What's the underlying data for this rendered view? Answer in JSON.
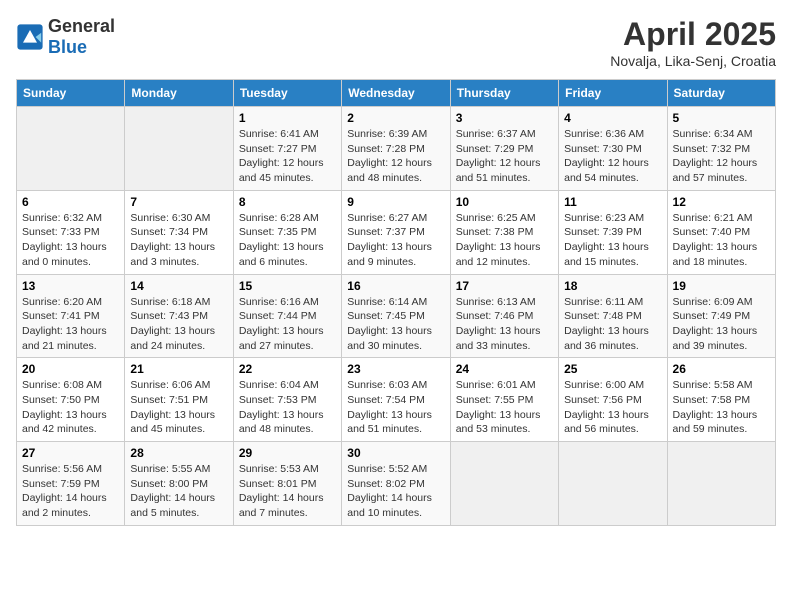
{
  "logo": {
    "text_general": "General",
    "text_blue": "Blue"
  },
  "title": "April 2025",
  "subtitle": "Novalja, Lika-Senj, Croatia",
  "days_of_week": [
    "Sunday",
    "Monday",
    "Tuesday",
    "Wednesday",
    "Thursday",
    "Friday",
    "Saturday"
  ],
  "weeks": [
    [
      {
        "day": "",
        "info": ""
      },
      {
        "day": "",
        "info": ""
      },
      {
        "day": "1",
        "info": "Sunrise: 6:41 AM\nSunset: 7:27 PM\nDaylight: 12 hours\nand 45 minutes."
      },
      {
        "day": "2",
        "info": "Sunrise: 6:39 AM\nSunset: 7:28 PM\nDaylight: 12 hours\nand 48 minutes."
      },
      {
        "day": "3",
        "info": "Sunrise: 6:37 AM\nSunset: 7:29 PM\nDaylight: 12 hours\nand 51 minutes."
      },
      {
        "day": "4",
        "info": "Sunrise: 6:36 AM\nSunset: 7:30 PM\nDaylight: 12 hours\nand 54 minutes."
      },
      {
        "day": "5",
        "info": "Sunrise: 6:34 AM\nSunset: 7:32 PM\nDaylight: 12 hours\nand 57 minutes."
      }
    ],
    [
      {
        "day": "6",
        "info": "Sunrise: 6:32 AM\nSunset: 7:33 PM\nDaylight: 13 hours\nand 0 minutes."
      },
      {
        "day": "7",
        "info": "Sunrise: 6:30 AM\nSunset: 7:34 PM\nDaylight: 13 hours\nand 3 minutes."
      },
      {
        "day": "8",
        "info": "Sunrise: 6:28 AM\nSunset: 7:35 PM\nDaylight: 13 hours\nand 6 minutes."
      },
      {
        "day": "9",
        "info": "Sunrise: 6:27 AM\nSunset: 7:37 PM\nDaylight: 13 hours\nand 9 minutes."
      },
      {
        "day": "10",
        "info": "Sunrise: 6:25 AM\nSunset: 7:38 PM\nDaylight: 13 hours\nand 12 minutes."
      },
      {
        "day": "11",
        "info": "Sunrise: 6:23 AM\nSunset: 7:39 PM\nDaylight: 13 hours\nand 15 minutes."
      },
      {
        "day": "12",
        "info": "Sunrise: 6:21 AM\nSunset: 7:40 PM\nDaylight: 13 hours\nand 18 minutes."
      }
    ],
    [
      {
        "day": "13",
        "info": "Sunrise: 6:20 AM\nSunset: 7:41 PM\nDaylight: 13 hours\nand 21 minutes."
      },
      {
        "day": "14",
        "info": "Sunrise: 6:18 AM\nSunset: 7:43 PM\nDaylight: 13 hours\nand 24 minutes."
      },
      {
        "day": "15",
        "info": "Sunrise: 6:16 AM\nSunset: 7:44 PM\nDaylight: 13 hours\nand 27 minutes."
      },
      {
        "day": "16",
        "info": "Sunrise: 6:14 AM\nSunset: 7:45 PM\nDaylight: 13 hours\nand 30 minutes."
      },
      {
        "day": "17",
        "info": "Sunrise: 6:13 AM\nSunset: 7:46 PM\nDaylight: 13 hours\nand 33 minutes."
      },
      {
        "day": "18",
        "info": "Sunrise: 6:11 AM\nSunset: 7:48 PM\nDaylight: 13 hours\nand 36 minutes."
      },
      {
        "day": "19",
        "info": "Sunrise: 6:09 AM\nSunset: 7:49 PM\nDaylight: 13 hours\nand 39 minutes."
      }
    ],
    [
      {
        "day": "20",
        "info": "Sunrise: 6:08 AM\nSunset: 7:50 PM\nDaylight: 13 hours\nand 42 minutes."
      },
      {
        "day": "21",
        "info": "Sunrise: 6:06 AM\nSunset: 7:51 PM\nDaylight: 13 hours\nand 45 minutes."
      },
      {
        "day": "22",
        "info": "Sunrise: 6:04 AM\nSunset: 7:53 PM\nDaylight: 13 hours\nand 48 minutes."
      },
      {
        "day": "23",
        "info": "Sunrise: 6:03 AM\nSunset: 7:54 PM\nDaylight: 13 hours\nand 51 minutes."
      },
      {
        "day": "24",
        "info": "Sunrise: 6:01 AM\nSunset: 7:55 PM\nDaylight: 13 hours\nand 53 minutes."
      },
      {
        "day": "25",
        "info": "Sunrise: 6:00 AM\nSunset: 7:56 PM\nDaylight: 13 hours\nand 56 minutes."
      },
      {
        "day": "26",
        "info": "Sunrise: 5:58 AM\nSunset: 7:58 PM\nDaylight: 13 hours\nand 59 minutes."
      }
    ],
    [
      {
        "day": "27",
        "info": "Sunrise: 5:56 AM\nSunset: 7:59 PM\nDaylight: 14 hours\nand 2 minutes."
      },
      {
        "day": "28",
        "info": "Sunrise: 5:55 AM\nSunset: 8:00 PM\nDaylight: 14 hours\nand 5 minutes."
      },
      {
        "day": "29",
        "info": "Sunrise: 5:53 AM\nSunset: 8:01 PM\nDaylight: 14 hours\nand 7 minutes."
      },
      {
        "day": "30",
        "info": "Sunrise: 5:52 AM\nSunset: 8:02 PM\nDaylight: 14 hours\nand 10 minutes."
      },
      {
        "day": "",
        "info": ""
      },
      {
        "day": "",
        "info": ""
      },
      {
        "day": "",
        "info": ""
      }
    ]
  ]
}
